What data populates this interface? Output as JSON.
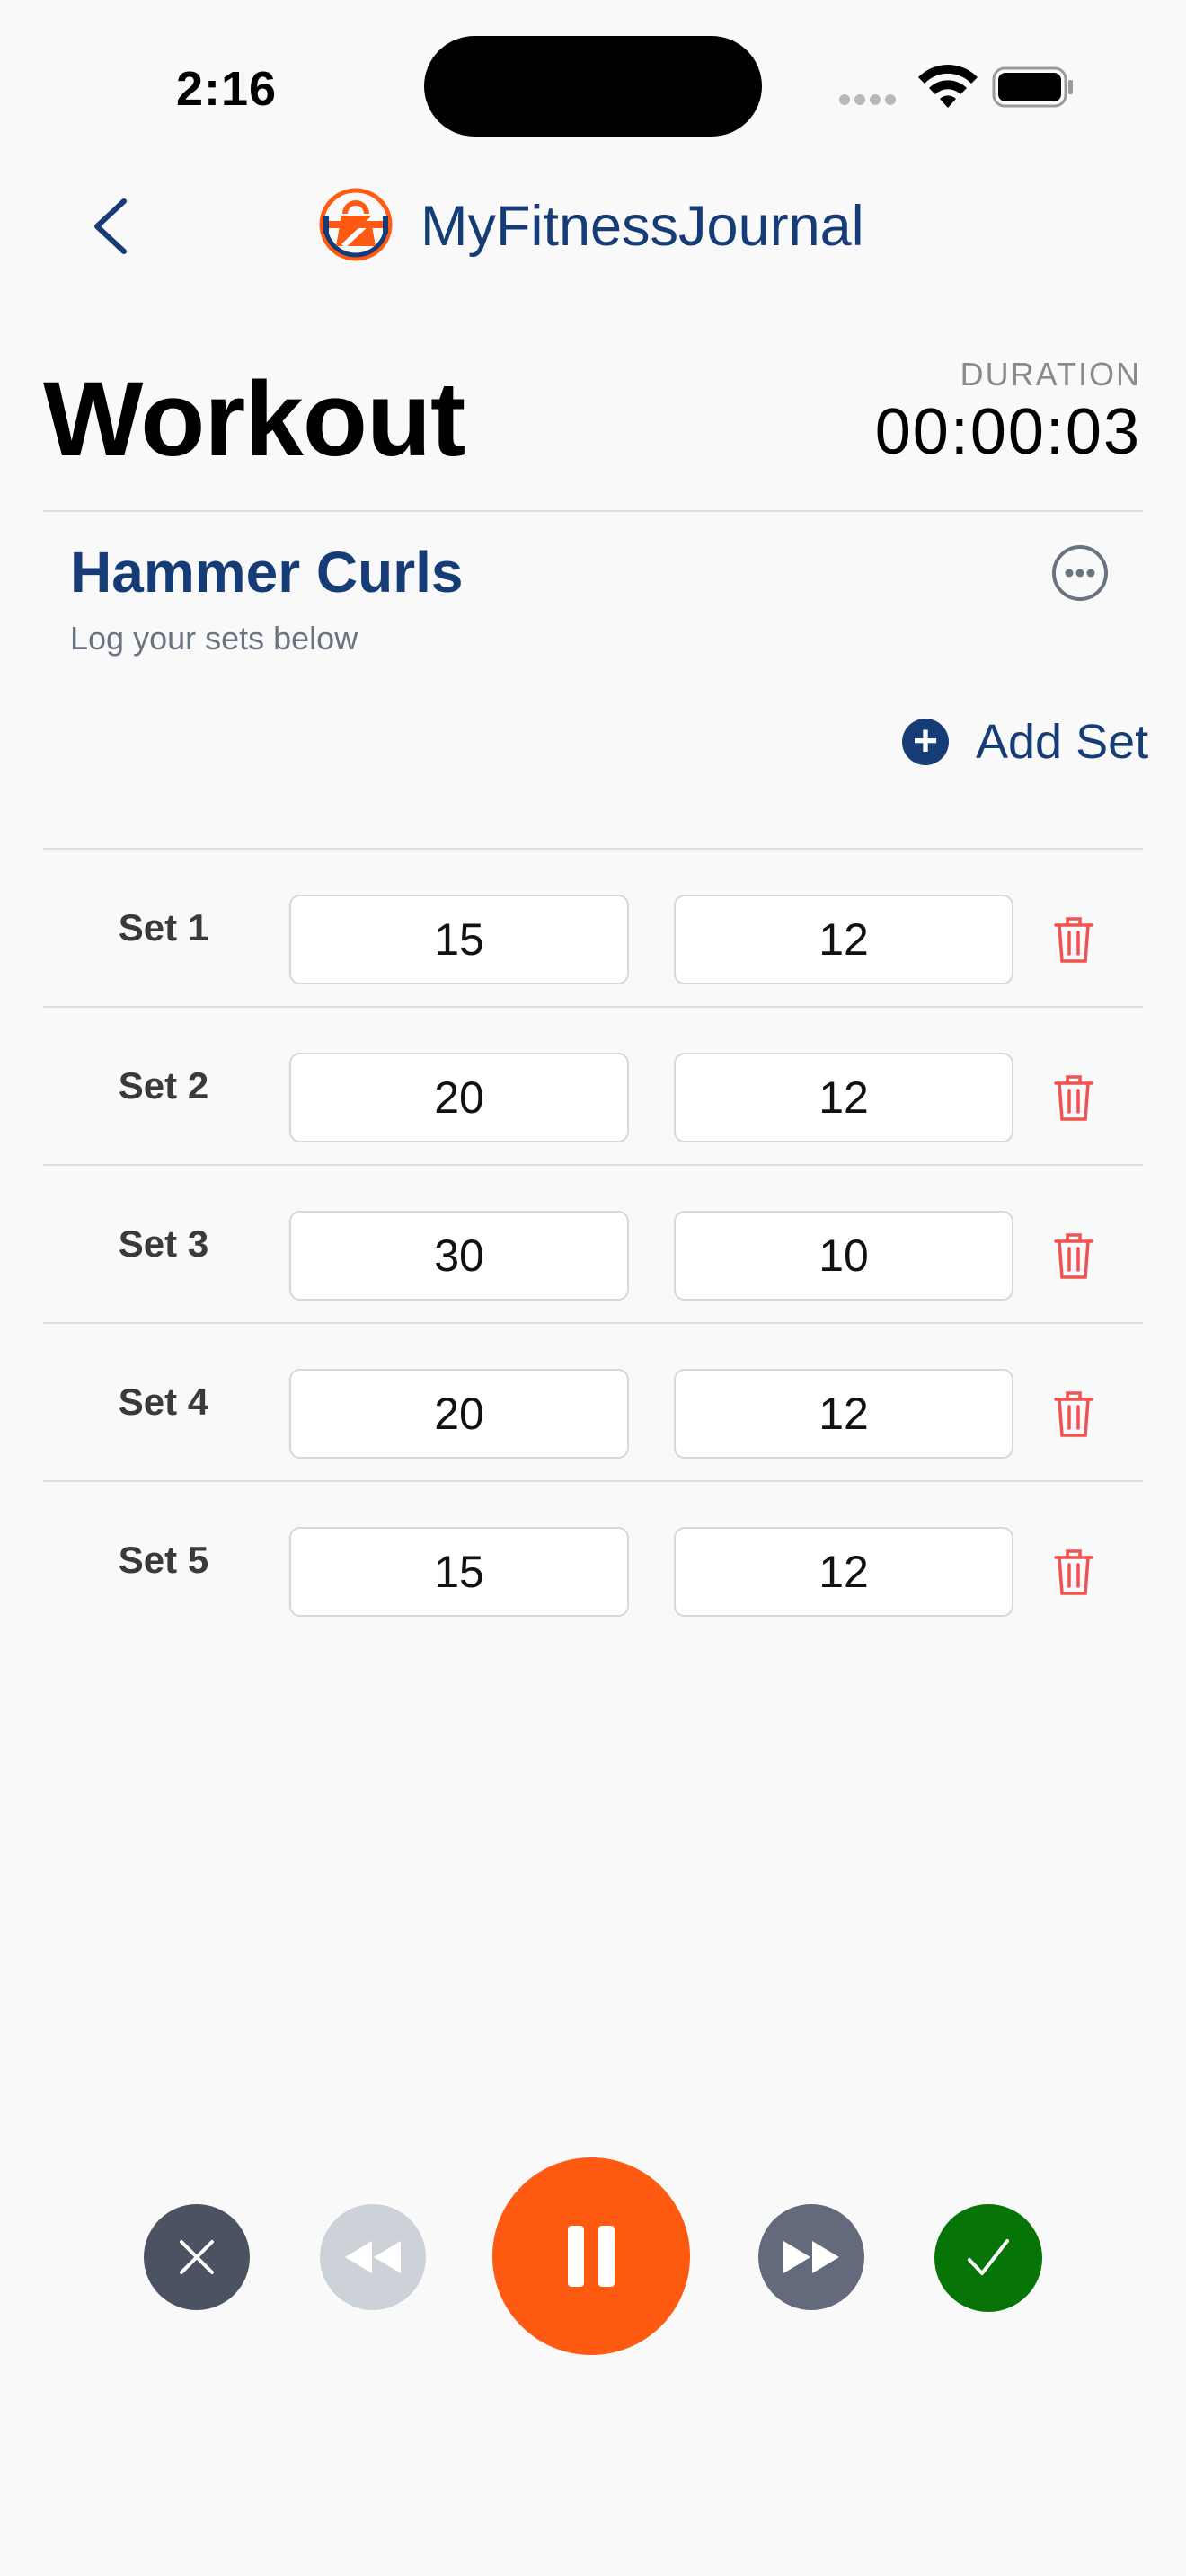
{
  "status_bar": {
    "time": "2:16"
  },
  "nav": {
    "app_title": "MyFitnessJournal",
    "back_icon": "chevron-left-icon",
    "logo_icon": "kettlebell-logo"
  },
  "header": {
    "title": "Workout",
    "duration_label": "DURATION",
    "duration_value": "00:00:03"
  },
  "exercise": {
    "name": "Hammer Curls",
    "subtitle": "Log your sets below",
    "more_icon": "ellipsis-circle-icon",
    "add_set_label": "Add Set"
  },
  "sets": [
    {
      "label": "Set 1",
      "weight": "15",
      "reps": "12"
    },
    {
      "label": "Set 2",
      "weight": "20",
      "reps": "12"
    },
    {
      "label": "Set 3",
      "weight": "30",
      "reps": "10"
    },
    {
      "label": "Set 4",
      "weight": "20",
      "reps": "12"
    },
    {
      "label": "Set 5",
      "weight": "15",
      "reps": "12"
    }
  ],
  "controls": {
    "cancel_icon": "x-icon",
    "rewind_icon": "rewind-icon",
    "pause_icon": "pause-icon",
    "forward_icon": "fast-forward-icon",
    "finish_icon": "checkmark-icon"
  },
  "colors": {
    "primary_navy": "#163c77",
    "accent_orange": "#ff5a12",
    "finish_green": "#067406",
    "delete_red": "#f05252",
    "background": "#f9f9f9"
  }
}
